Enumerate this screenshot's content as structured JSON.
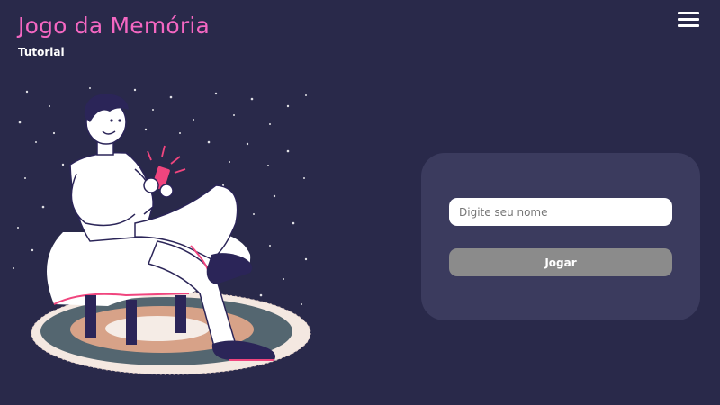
{
  "header": {
    "title": "Jogo da Memória",
    "subtitle": "Tutorial",
    "menu_icon": "hamburger-menu-icon"
  },
  "login": {
    "name_placeholder": "Digite seu nome",
    "name_value": "",
    "play_label": "Jogar"
  },
  "colors": {
    "background": "#29294a",
    "title": "#f467c2",
    "card": "#3b3b5e",
    "button_disabled": "#8b8b8b",
    "accent_pink": "#f0457e"
  }
}
